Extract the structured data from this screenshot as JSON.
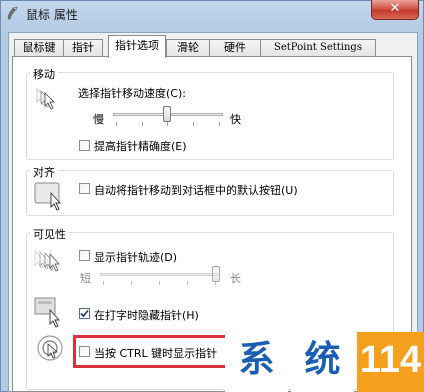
{
  "window": {
    "title": "鼠标 属性",
    "close_label": "✕"
  },
  "tabs": [
    {
      "label": "鼠标键"
    },
    {
      "label": "指针"
    },
    {
      "label": "指针选项",
      "active": true
    },
    {
      "label": "滑轮"
    },
    {
      "label": "硬件"
    },
    {
      "label": "SetPoint Settings"
    }
  ],
  "motion": {
    "heading": "移动",
    "speed_label": "选择指针移动速度(C):",
    "slow": "慢",
    "fast": "快",
    "speed_level": 0.5,
    "enhance_label": "提高指针精确度(E)",
    "enhance_checked": false
  },
  "snap": {
    "heading": "对齐",
    "snap_label": "自动将指针移动到对话框中的默认按钮(U)",
    "snap_checked": false
  },
  "visibility": {
    "heading": "可见性",
    "trails_label": "显示指针轨迹(D)",
    "trails_checked": false,
    "short": "短",
    "long": "长",
    "trails_level": 0.98,
    "hide_label": "在打字时隐藏指针(H)",
    "hide_checked": true,
    "ctrl_label": "当按 CTRL 键时显示指针",
    "ctrl_checked": false
  },
  "watermark": {
    "char1": "系",
    "char2": "统",
    "number": "114"
  },
  "colors": {
    "accent_blue": "#1a5fb4",
    "watermark_orange": "#f5a01d",
    "highlight_red": "#d8333a"
  }
}
